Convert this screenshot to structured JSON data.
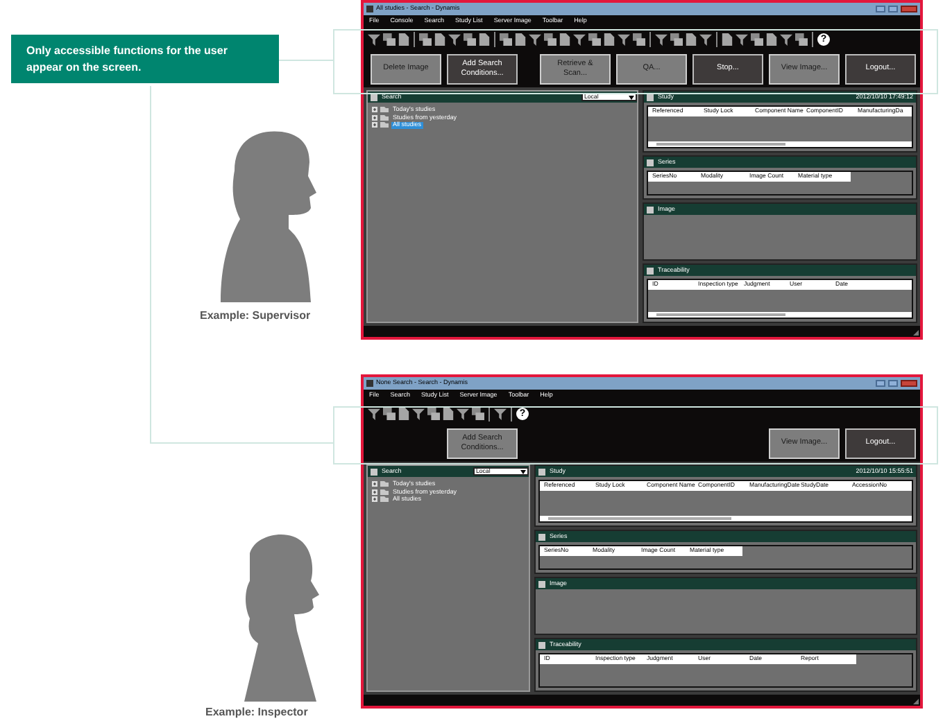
{
  "callout": "Only accessible functions for the user appear on the screen.",
  "windows": [
    {
      "caption": "Example: Supervisor",
      "title": "All studies - Search - Dynamis",
      "menu": [
        "File",
        "Console",
        "Search",
        "Study List",
        "Server Image",
        "Toolbar",
        "Help"
      ],
      "toolbar": [
        {
          "kind": "tool"
        },
        {
          "kind": "tool"
        },
        {
          "kind": "tool"
        },
        {
          "kind": "separator"
        },
        {
          "kind": "tool"
        },
        {
          "kind": "tool"
        },
        {
          "kind": "tool"
        },
        {
          "kind": "tool"
        },
        {
          "kind": "tool"
        },
        {
          "kind": "separator"
        },
        {
          "kind": "tool"
        },
        {
          "kind": "tool"
        },
        {
          "kind": "tool"
        },
        {
          "kind": "tool"
        },
        {
          "kind": "tool"
        },
        {
          "kind": "tool"
        },
        {
          "kind": "tool"
        },
        {
          "kind": "tool"
        },
        {
          "kind": "tool"
        },
        {
          "kind": "tool"
        },
        {
          "kind": "separator"
        },
        {
          "kind": "tool"
        },
        {
          "kind": "tool"
        },
        {
          "kind": "tool"
        },
        {
          "kind": "tool"
        },
        {
          "kind": "separator"
        },
        {
          "kind": "tool"
        },
        {
          "kind": "tool"
        },
        {
          "kind": "tool"
        },
        {
          "kind": "tool"
        },
        {
          "kind": "tool"
        },
        {
          "kind": "tool"
        },
        {
          "kind": "separator"
        },
        {
          "kind": "help",
          "label": "?"
        }
      ],
      "left_buttons": [
        {
          "label": "Delete Image",
          "kind": "light"
        },
        {
          "label": "Add Search Conditions...",
          "kind": "dark"
        }
      ],
      "right_buttons": [
        {
          "label": "Retrieve & Scan...",
          "kind": "light"
        },
        {
          "label": "QA...",
          "kind": "light"
        },
        {
          "label": "Stop...",
          "kind": "dark"
        },
        {
          "label": "View Image...",
          "kind": "light"
        },
        {
          "label": "Logout...",
          "kind": "dark"
        }
      ],
      "search": {
        "title": "Search",
        "source": "Local",
        "items": [
          {
            "label": "Today's studies",
            "expanded": false,
            "selected": false
          },
          {
            "label": "Studies from yesterday",
            "expanded": false,
            "selected": false
          },
          {
            "label": "All studies",
            "expanded": false,
            "selected": true
          }
        ]
      },
      "study": {
        "title": "Study",
        "timestamp": "2012/10/10 17:49:12",
        "columns": [
          "Referenced",
          "Study Lock",
          "Component Name",
          "ComponentID",
          "ManufacturingDa"
        ]
      },
      "series": {
        "title": "Series",
        "columns": [
          "SeriesNo",
          "Modality",
          "Image Count",
          "Material type"
        ]
      },
      "image": {
        "title": "Image"
      },
      "traceability": {
        "title": "Traceability",
        "columns": [
          "ID",
          "Inspection type",
          "Judgment",
          "User",
          "Date"
        ]
      }
    },
    {
      "caption": "Example: Inspector",
      "title": "None Search - Search - Dynamis",
      "menu": [
        "File",
        "Search",
        "Study List",
        "Server Image",
        "Toolbar",
        "Help"
      ],
      "toolbar": [
        {
          "kind": "tool"
        },
        {
          "kind": "tool"
        },
        {
          "kind": "tool"
        },
        {
          "kind": "tool"
        },
        {
          "kind": "tool"
        },
        {
          "kind": "tool"
        },
        {
          "kind": "tool"
        },
        {
          "kind": "tool"
        },
        {
          "kind": "separator"
        },
        {
          "kind": "tool"
        },
        {
          "kind": "separator"
        },
        {
          "kind": "help",
          "label": "?"
        }
      ],
      "left_buttons": [
        {
          "label": "Add Search Conditions...",
          "kind": "light"
        }
      ],
      "right_buttons": [
        {
          "label": "View Image...",
          "kind": "light"
        },
        {
          "label": "Logout...",
          "kind": "dark"
        }
      ],
      "search": {
        "title": "Search",
        "source": "Local",
        "items": [
          {
            "label": "Today's studies",
            "expanded": false,
            "selected": false
          },
          {
            "label": "Studies from yesterday",
            "expanded": false,
            "selected": false
          },
          {
            "label": "All studies",
            "expanded": false,
            "selected": false
          }
        ]
      },
      "study": {
        "title": "Study",
        "timestamp": "2012/10/10 15:55:51",
        "columns": [
          "Referenced",
          "Study Lock",
          "Component Name",
          "ComponentID",
          "ManufacturingDate",
          "StudyDate",
          "AccessionNo"
        ]
      },
      "series": {
        "title": "Series",
        "columns": [
          "SeriesNo",
          "Modality",
          "Image Count",
          "Material type"
        ]
      },
      "image": {
        "title": "Image"
      },
      "traceability": {
        "title": "Traceability",
        "columns": [
          "ID",
          "Inspection type",
          "Judgment",
          "User",
          "Date",
          "Report"
        ]
      }
    }
  ]
}
